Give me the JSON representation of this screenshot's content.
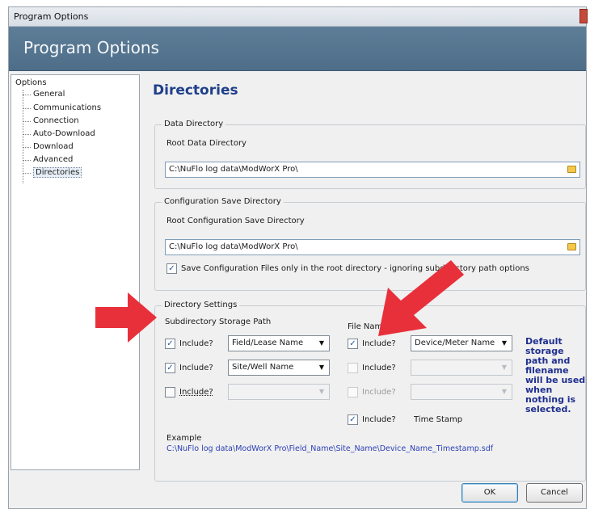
{
  "window": {
    "title": "Program Options",
    "banner_title": "Program Options"
  },
  "tree": {
    "root": "Options",
    "items": [
      "General",
      "Communications",
      "Connection",
      "Auto-Download",
      "Download",
      "Advanced",
      "Directories"
    ],
    "selected": "Directories"
  },
  "page": {
    "heading": "Directories"
  },
  "data_directory": {
    "legend": "Data Directory",
    "label": "Root Data Directory",
    "value": "C:\\NuFlo log data\\ModWorX Pro\\"
  },
  "config_directory": {
    "legend": "Configuration Save Directory",
    "label": "Root Configuration Save Directory",
    "value": "C:\\NuFlo log data\\ModWorX Pro\\",
    "checkbox_label": "Save Configuration Files only in the root directory - ignoring subdirectory path options",
    "checkbox_checked": true
  },
  "directory_settings": {
    "legend": "Directory Settings",
    "subdir_title": "Subdirectory Storage Path",
    "subdir_rows": [
      {
        "label": "Include?",
        "checked": true,
        "value": "Field/Lease Name",
        "enabled": true
      },
      {
        "label": "Include?",
        "checked": true,
        "value": "Site/Well Name",
        "enabled": true
      },
      {
        "label": "Include?",
        "checked": false,
        "value": "",
        "enabled": false
      }
    ],
    "file_title": "File Name",
    "file_rows": [
      {
        "label": "Include?",
        "checked": true,
        "value": "Device/Meter Name",
        "enabled": true
      },
      {
        "label": "Include?",
        "checked": false,
        "value": "",
        "enabled": false
      },
      {
        "label": "Include?",
        "checked": false,
        "value": "",
        "enabled": false
      }
    ],
    "timestamp_row": {
      "label": "Include?",
      "checked": true,
      "value": "Time Stamp"
    },
    "note": "Default storage path and filename will be used when nothing is selected.",
    "example_label": "Example",
    "example_path": "C:\\NuFlo log data\\ModWorX Pro\\Field_Name\\Site_Name\\Device_Name_Timestamp.sdf"
  },
  "buttons": {
    "ok": "OK",
    "cancel": "Cancel"
  },
  "colors": {
    "banner": "#56768f",
    "heading": "#1f3f8a",
    "note": "#1f2f8f",
    "example_path": "#2a3fb5",
    "callout_arrow": "#e8303b"
  },
  "icons": {
    "check": "✓",
    "dropdown": "▼"
  }
}
